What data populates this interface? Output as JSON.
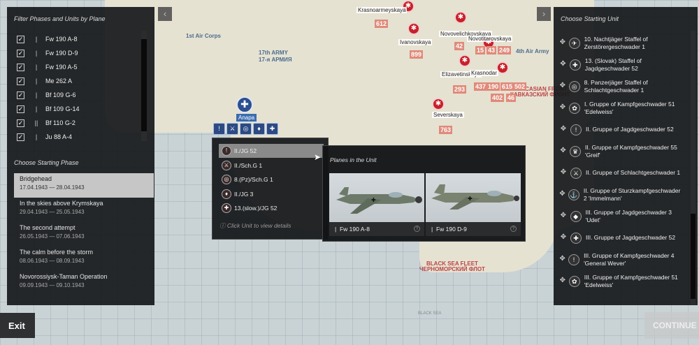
{
  "map": {
    "labels": [
      {
        "text": "17-я АРМИЯ",
        "cls": "",
        "style": "left:370px;top:82px"
      },
      {
        "text": "17th ARMY",
        "cls": "",
        "style": "left:370px;top:72px"
      },
      {
        "text": "BLACK SEA FLEET\nЧЕРНОМОРСКИЙ ФЛОТ",
        "cls": "red",
        "style": "left:600px;top:374px"
      },
      {
        "text": "CAUCASIAN FRONT\nКАВКАЗСКИЙ ФРОНТ",
        "cls": "red",
        "style": "left:730px;top:124px"
      },
      {
        "text": "4th Air Army",
        "cls": "",
        "style": "left:738px;top:70px"
      },
      {
        "text": "1st Air Corps",
        "cls": "",
        "style": "left:266px;top:48px"
      }
    ],
    "towns": [
      "Krasnoarmeyskaya",
      "Ivanovskaya",
      "Novovelichkovskaya",
      "Novotitarovskaya",
      "Elizavetinskaya",
      "Krasnodar",
      "Severskaya"
    ],
    "numbers": [
      "612",
      "899",
      "42",
      "15",
      "43",
      "249",
      "293",
      "437",
      "190",
      "615",
      "502",
      "402",
      "46",
      "763"
    ],
    "anapa": "Anapa",
    "black_sea_small": "BLACK SEA"
  },
  "left_panel": {
    "filter_title": "Filter Phases and Units by Plane",
    "planes": [
      {
        "checked": "✓",
        "icon": "|",
        "label": "Fw 190 A-8"
      },
      {
        "checked": "✓",
        "icon": "|",
        "label": "Fw 190 D-9"
      },
      {
        "checked": "✓",
        "icon": "|",
        "label": "Fw 190 A-5"
      },
      {
        "checked": "✓",
        "icon": "|",
        "label": "Me 262 A"
      },
      {
        "checked": "✓",
        "icon": "|",
        "label": "Bf 109 G-6"
      },
      {
        "checked": "✓",
        "icon": "|",
        "label": "Bf 109 G-14"
      },
      {
        "checked": "✓",
        "icon": "||",
        "label": "Bf 110 G-2"
      },
      {
        "checked": "✓",
        "icon": "|",
        "label": "Ju 88 A-4"
      }
    ],
    "phase_title": "Choose Starting Phase",
    "phases": [
      {
        "name": "Bridgehead",
        "dates": "17.04.1943 — 28.04.1943",
        "selected": true
      },
      {
        "name": "In the skies above Krymskaya",
        "dates": "29.04.1943 — 25.05.1943",
        "selected": false
      },
      {
        "name": "The second attempt",
        "dates": "26.05.1943 — 07.06.1943",
        "selected": false
      },
      {
        "name": "The calm before the storm",
        "dates": "08.06.1943 — 08.09.1943",
        "selected": false
      },
      {
        "name": "Novorossiysk-Taman Operation",
        "dates": "09.09.1943 — 09.10.1943",
        "selected": false
      }
    ]
  },
  "unit_popup": {
    "units": [
      {
        "label": "II./JG 52",
        "emblem": "!",
        "selected": true
      },
      {
        "label": "II./Sch.G 1",
        "emblem": "⚔",
        "selected": false
      },
      {
        "label": "8.(Pz)/Sch.G 1",
        "emblem": "◎",
        "selected": false
      },
      {
        "label": "II./JG 3",
        "emblem": "♦",
        "selected": false
      },
      {
        "label": "13.(slow.)/JG 52",
        "emblem": "✚",
        "selected": false
      }
    ],
    "hint": "Click Unit to view details"
  },
  "planes_panel": {
    "title": "Planes in the Unit",
    "planes": [
      "Fw 190 A-8",
      "Fw 190 D-9"
    ]
  },
  "right_panel": {
    "title": "Choose Starting Unit",
    "units": [
      {
        "emblem": "✈",
        "label": "10. Nachtjäger Staffel of Zerstörergeschwader 1"
      },
      {
        "emblem": "✚",
        "label": "13. (Slovak) Staffel of Jagdgeschwader 52"
      },
      {
        "emblem": "◎",
        "label": "8. Panzerjäger Staffel of Schlachtgeschwader 1"
      },
      {
        "emblem": "✿",
        "label": "I. Gruppe of Kampfgeschwader 51 'Edelweiss'"
      },
      {
        "emblem": "!",
        "label": "II. Gruppe of Jagdgeschwader 52"
      },
      {
        "emblem": "♛",
        "label": "II. Gruppe of Kampfgeschwader 55 'Greif'"
      },
      {
        "emblem": "⚔",
        "label": "II. Gruppe of Schlachtgeschwader 1"
      },
      {
        "emblem": "⚓",
        "label": "II. Gruppe of Sturzkampfgeschwader 2 'Immelmann'"
      },
      {
        "emblem": "◆",
        "label": "III. Gruppe of Jagdgeschwader 3 'Udet'"
      },
      {
        "emblem": "✚",
        "label": "III. Gruppe of Jagdgeschwader 52"
      },
      {
        "emblem": "!",
        "label": "III. Gruppe of Kampfgeschwader 4 'General Wever'"
      },
      {
        "emblem": "✿",
        "label": "III. Gruppe of Kampfgeschwader 51 'Edelweiss'"
      }
    ]
  },
  "buttons": {
    "exit": "Exit",
    "continue": "CONTINUE"
  },
  "icons": {
    "drag": "✥",
    "help": "?",
    "prev": "‹",
    "next": "›",
    "anapa_marker": "✚"
  }
}
